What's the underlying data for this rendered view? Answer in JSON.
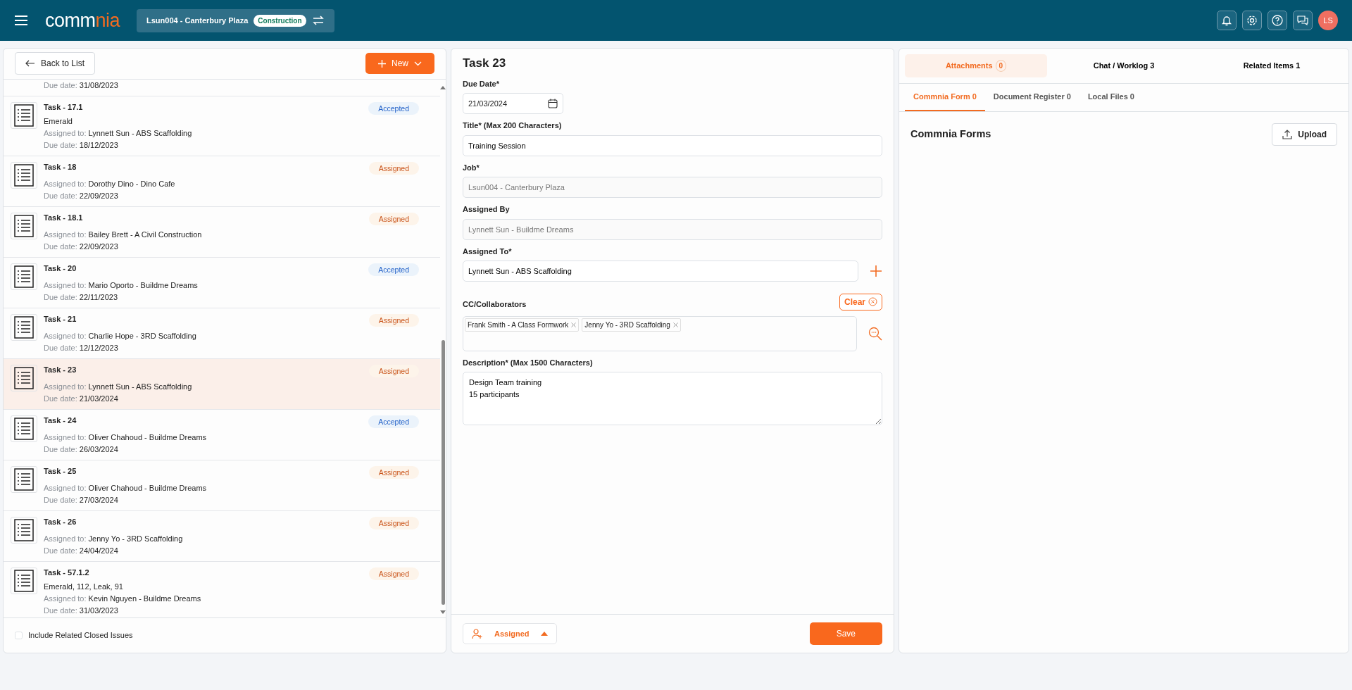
{
  "topbar": {
    "logo": [
      {
        "text": "comm",
        "kind": "plain"
      },
      {
        "text": "nia",
        "kind": "accent"
      }
    ],
    "job": {
      "label": "Lsun004 - Canterbury Plaza",
      "tag": "Construction"
    },
    "avatar": "LS"
  },
  "list_panel": {
    "back_button": "Back to List",
    "new_button": "New",
    "items": [
      {
        "due_label": "Due date:",
        "due_date": "31/08/2023",
        "selected": false
      },
      {
        "title": "Task - 17.1",
        "subtitle": "Emerald",
        "assigned_label": "Assigned to:",
        "assigned_to": "Lynnett Sun - ABS Scaffolding",
        "due_label": "Due date:",
        "due_date": "18/12/2023",
        "status": "Accepted",
        "kind": "accepted",
        "selected": false
      },
      {
        "title": "Task - 18",
        "assigned_label": "Assigned to:",
        "assigned_to": "Dorothy Dino - Dino Cafe",
        "due_label": "Due date:",
        "due_date": "22/09/2023",
        "status": "Assigned",
        "kind": "assigned",
        "selected": false
      },
      {
        "title": "Task - 18.1",
        "assigned_label": "Assigned to:",
        "assigned_to": "Bailey Brett - A Civil Construction",
        "due_label": "Due date:",
        "due_date": "22/09/2023",
        "status": "Assigned",
        "kind": "assigned",
        "selected": false
      },
      {
        "title": "Task - 20",
        "assigned_label": "Assigned to:",
        "assigned_to": "Mario Oporto - Buildme Dreams",
        "due_label": "Due date:",
        "due_date": "22/11/2023",
        "status": "Accepted",
        "kind": "accepted",
        "selected": false
      },
      {
        "title": "Task - 21",
        "assigned_label": "Assigned to:",
        "assigned_to": "Charlie Hope - 3RD Scaffolding",
        "due_label": "Due date:",
        "due_date": "12/12/2023",
        "status": "Assigned",
        "kind": "assigned",
        "selected": false
      },
      {
        "title": "Task - 23",
        "assigned_label": "Assigned to:",
        "assigned_to": "Lynnett Sun - ABS Scaffolding",
        "due_label": "Due date:",
        "due_date": "21/03/2024",
        "status": "Assigned",
        "kind": "assigned",
        "selected": true
      },
      {
        "title": "Task - 24",
        "assigned_label": "Assigned to:",
        "assigned_to": "Oliver Chahoud - Buildme Dreams",
        "due_label": "Due date:",
        "due_date": "26/03/2024",
        "status": "Accepted",
        "kind": "accepted",
        "selected": false
      },
      {
        "title": "Task - 25",
        "assigned_label": "Assigned to:",
        "assigned_to": "Oliver Chahoud - Buildme Dreams",
        "due_label": "Due date:",
        "due_date": "27/03/2024",
        "status": "Assigned",
        "kind": "assigned",
        "selected": false
      },
      {
        "title": "Task - 26",
        "assigned_label": "Assigned to:",
        "assigned_to": "Jenny Yo - 3RD Scaffolding",
        "due_label": "Due date:",
        "due_date": "24/04/2024",
        "status": "Assigned",
        "kind": "assigned",
        "selected": false
      },
      {
        "title": "Task - 57.1.2",
        "subtitle": "Emerald, 112, Leak, 91",
        "assigned_label": "Assigned to:",
        "assigned_to": "Kevin Nguyen - Buildme Dreams",
        "due_label": "Due date:",
        "due_date": "31/03/2023",
        "status": "Assigned",
        "kind": "assigned",
        "selected": false
      }
    ],
    "include_closed": {
      "label": "Include Related Closed Issues",
      "checked": false
    }
  },
  "form": {
    "heading": "Task 23",
    "due_date": {
      "label": "Due Date*",
      "value": "21/03/2024"
    },
    "title": {
      "label": "Title* (Max 200 Characters)",
      "value": "Training Session"
    },
    "job": {
      "label": "Job*",
      "value": "Lsun004 - Canterbury Plaza",
      "disabled": true
    },
    "assigned_by": {
      "label": "Assigned By",
      "value": "Lynnett Sun - Buildme Dreams",
      "disabled": true
    },
    "assigned_to": {
      "label": "Assigned To*",
      "value": "Lynnett Sun - ABS Scaffolding"
    },
    "cc": {
      "label": "CC/Collaborators",
      "clear": "Clear",
      "tags": [
        "Frank Smith - A Class Formwork",
        "Jenny Yo - 3RD Scaffolding"
      ]
    },
    "description": {
      "label": "Description* (Max 1500 Characters)",
      "value": "Design Team training\n15 participants"
    },
    "status_button": "Assigned",
    "save_button": "Save"
  },
  "attachments_panel": {
    "tabs": [
      {
        "label": "Attachments",
        "count": "0",
        "selected": true
      },
      {
        "label": "Chat / Worklog 3",
        "selected": false
      },
      {
        "label": "Related Items 1",
        "selected": false
      }
    ],
    "subtabs": [
      {
        "label": "Commnia Form 0",
        "selected": true
      },
      {
        "label": "Document Register 0",
        "selected": false
      },
      {
        "label": "Local Files 0",
        "selected": false
      }
    ],
    "heading": "Commnia Forms",
    "upload_button": "Upload"
  }
}
